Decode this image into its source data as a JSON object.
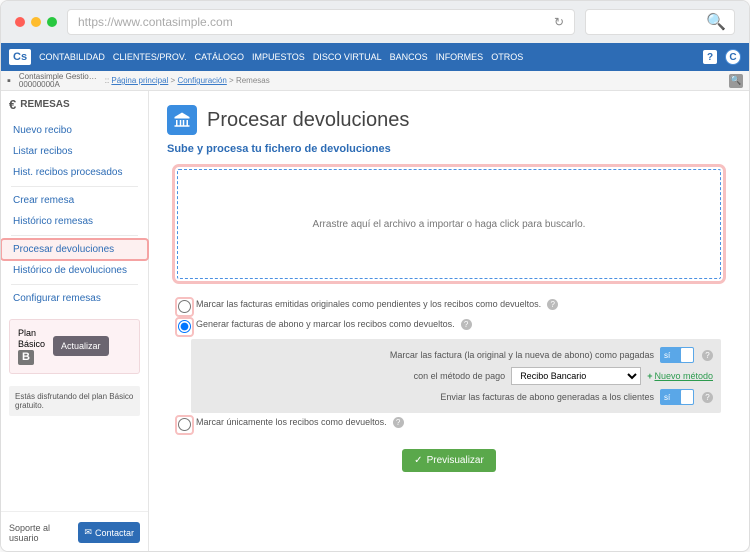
{
  "browser": {
    "url": "https://www.contasimple.com"
  },
  "topnav": {
    "logo": "Cs",
    "items": [
      "CONTABILIDAD",
      "CLIENTES/PROV.",
      "CATÁLOGO",
      "IMPUESTOS",
      "DISCO VIRTUAL",
      "BANCOS",
      "INFORMES",
      "OTROS"
    ],
    "avatar": "C"
  },
  "subbar": {
    "company": "Contasimple Gestio…",
    "company_id": "00000000A",
    "crumb_home": "Página principal",
    "crumb_config": "Configuración",
    "crumb_current": "Remesas"
  },
  "sidebar": {
    "title": "REMESAS",
    "items": [
      "Nuevo recibo",
      "Listar recibos",
      "Hist. recibos procesados",
      "Crear remesa",
      "Histórico remesas",
      "Procesar devoluciones",
      "Histórico de devoluciones",
      "Configurar remesas"
    ],
    "plan_label": "Plan",
    "plan_name": "Básico",
    "plan_badge": "B",
    "update_btn": "Actualizar",
    "plan_note": "Estás disfrutando del plan Básico gratuito.",
    "support_label": "Soporte al usuario",
    "contact_btn": "Contactar"
  },
  "main": {
    "title": "Procesar devoluciones",
    "subtitle": "Sube y procesa tu fichero de devoluciones",
    "dropzone": "Arrastre aquí el archivo a importar o haga click para buscarlo.",
    "opt1": "Marcar las facturas emitidas originales como pendientes y los recibos como devueltos.",
    "opt2": "Generar facturas de abono y marcar los recibos como devueltos.",
    "sub_mark_paid": "Marcar las factura (la original y la nueva de abono) como pagadas",
    "sub_method": "con el método de pago",
    "method_value": "Recibo Bancario",
    "new_method": "Nuevo método",
    "sub_send": "Enviar las facturas de abono generadas a los clientes",
    "toggle_yes": "sí",
    "opt3": "Marcar únicamente los recibos como devueltos.",
    "preview_btn": "Previsualizar"
  }
}
